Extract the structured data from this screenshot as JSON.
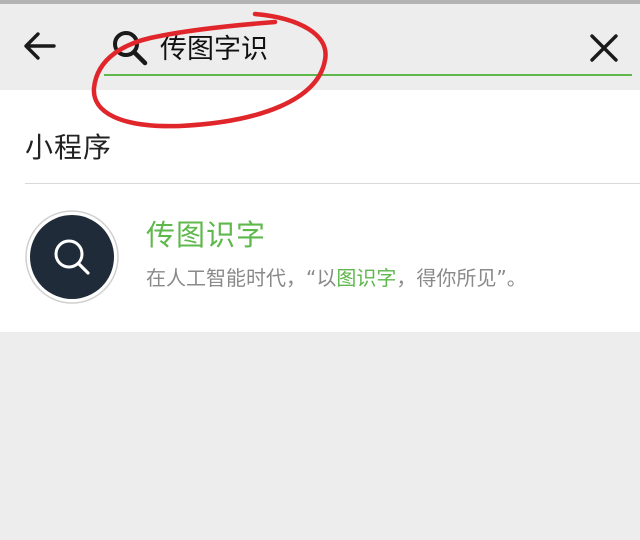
{
  "search": {
    "query": "传图字识",
    "back_icon": "arrow-left-icon",
    "search_icon": "search-icon",
    "clear_icon": "close-icon"
  },
  "section": {
    "title": "小程序"
  },
  "result": {
    "name": "传图识字",
    "logo_icon": "magnifier-icon",
    "description_prefix": "在人工智能时代，“以",
    "description_highlight": "图识字",
    "description_suffix": "，得你所见”。"
  },
  "colors": {
    "accent": "#5fb84c",
    "logo_bg": "#1f2b38",
    "annotation": "#e0262a",
    "background": "#ededed"
  }
}
